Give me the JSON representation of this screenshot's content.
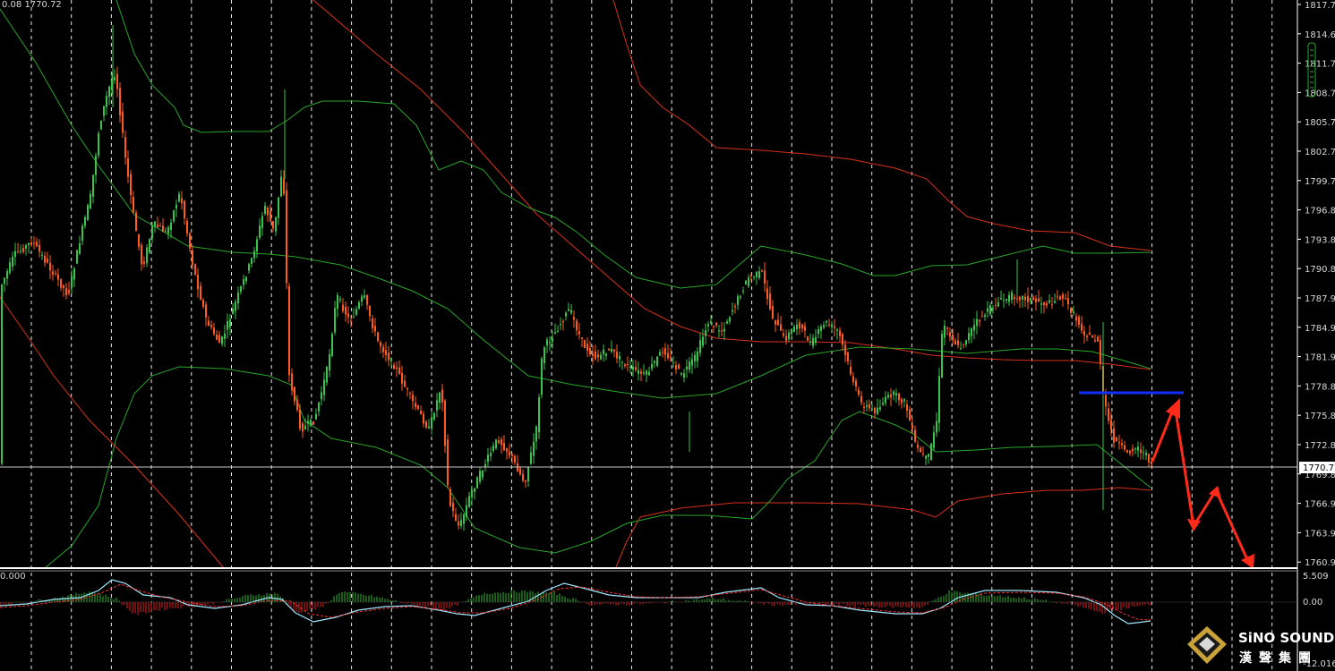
{
  "header": {
    "ohlc_text": "0.08 1770.72"
  },
  "price_axis": {
    "ticks": [
      "1817.70",
      "1814.65",
      "1811.70",
      "1808.75",
      "1805.75",
      "1802.75",
      "1799.75",
      "1796.80",
      "1793.85",
      "1790.85",
      "1787.90",
      "1784.90",
      "1781.95",
      "1778.85",
      "1775.85",
      "1772.85",
      "1769.85",
      "1766.90",
      "1763.90",
      "1760.90"
    ],
    "current_price": "1770.72"
  },
  "indicator_axis": {
    "top": "5.509",
    "mid": "0.00",
    "bottom": "-12.016",
    "left_value": "0.000"
  },
  "logo": {
    "brand": "SiNO SOUND",
    "chinese": "漢聲集團"
  },
  "colors": {
    "background": "#000000",
    "bull_candle": "#39c44a",
    "bear_candle": "#ff5a1f",
    "band_green": "#2aa52a",
    "band_red": "#d8301c",
    "forecast_arrow": "#ff2a1a",
    "resistance_line": "#1030ff",
    "macd_line": "#9fe8ff",
    "signal_line": "#ff3030"
  },
  "chart_data": {
    "type": "candlestick",
    "symbol_price_scale": {
      "ymin": 1760.9,
      "ymax": 1817.7
    },
    "current_price": 1770.72,
    "resistance_level": 1778.4,
    "forecast_path": [
      1770.7,
      1777.5,
      1765.6,
      1768.8,
      1760.9
    ],
    "key_levels_shown": [
      1793.85,
      1787.9,
      1778.85,
      1769.85,
      1763.9
    ],
    "indicator": {
      "type": "macd",
      "range": [
        -12.016,
        5.509
      ]
    },
    "grid": "vertical dashed"
  }
}
